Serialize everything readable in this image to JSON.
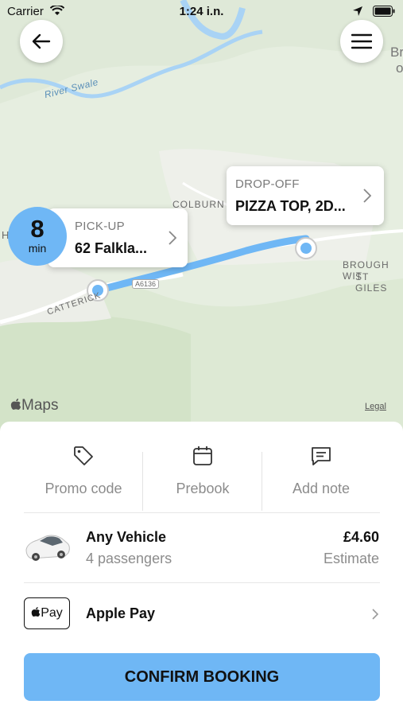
{
  "status_bar": {
    "carrier": "Carrier",
    "time": "1:24 i.n."
  },
  "map": {
    "place_labels": {
      "river": "River Swale",
      "colburn": "COLBURN",
      "brough": "BROUGH WIT",
      "st_giles": "ST GILES",
      "catterick": "CATTERICK",
      "road": "A6136",
      "edge_top": "Br",
      "edge_top2": "o",
      "edge_left": "H"
    },
    "attribution": "Maps",
    "legal": "Legal",
    "eta": {
      "value": "8",
      "unit": "min"
    },
    "pickup": {
      "label": "PICK-UP",
      "value": "62 Falkla..."
    },
    "dropoff": {
      "label": "DROP-OFF",
      "value": "PIZZA TOP, 2D..."
    },
    "route_color": "#6fb7f5"
  },
  "actions": [
    {
      "label": "Promo code",
      "icon": "tag-icon"
    },
    {
      "label": "Prebook",
      "icon": "calendar-icon"
    },
    {
      "label": "Add note",
      "icon": "note-icon"
    }
  ],
  "vehicle": {
    "name": "Any Vehicle",
    "passengers": "4 passengers",
    "price": "£4.60",
    "price_note": "Estimate"
  },
  "payment": {
    "badge": "Pay",
    "method": "Apple Pay"
  },
  "confirm_label": "CONFIRM BOOKING",
  "accent_color": "#6fb7f5"
}
